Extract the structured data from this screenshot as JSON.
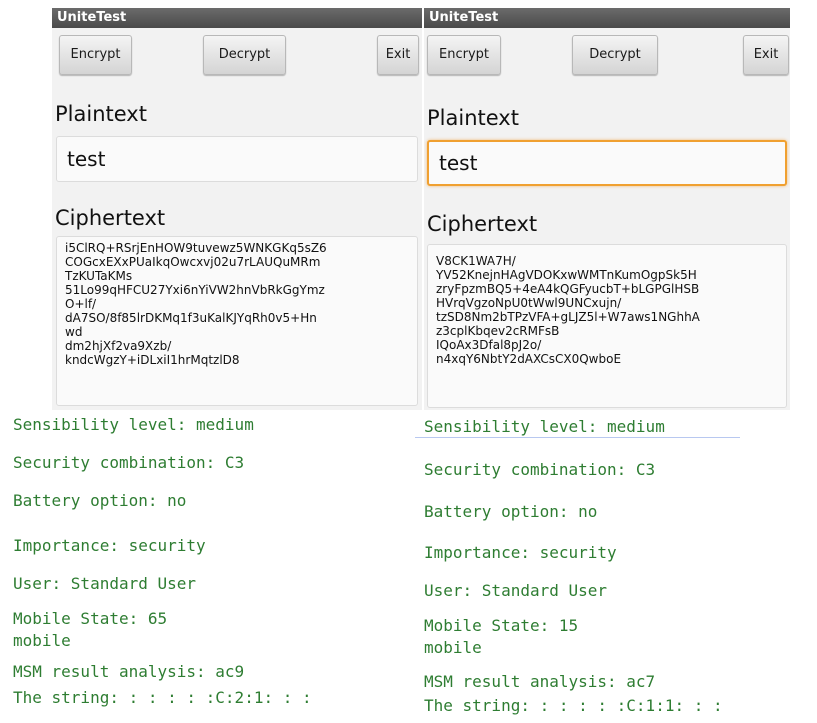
{
  "left_screen": {
    "title": "UniteTest",
    "buttons": {
      "encrypt": "Encrypt",
      "decrypt": "Decrypt",
      "exit": "Exit"
    },
    "plaintext_label": "Plaintext",
    "plaintext_value": "test",
    "ciphertext_label": "Ciphertext",
    "ciphertext_value": "i5ClRQ+RSrjEnHOW9tuvewz5WNKGKq5sZ6\nCOGcxEXxPUaIkqOwcxvj02u7rLAUQuMRm\nTzKUTaKMs\n51Lo99qHFCU27Yxi6nYiVW2hnVbRkGgYmz\nO+lf/\ndA7SO/8f85lrDKMq1f3uKalKJYqRh0v5+Hn\nwd\ndm2hjXf2va9Xzb/\nkndcWgzY+iDLxiI1hrMqtzlD8"
  },
  "right_screen": {
    "title": "UniteTest",
    "buttons": {
      "encrypt": "Encrypt",
      "decrypt": "Decrypt",
      "exit": "Exit"
    },
    "plaintext_label": "Plaintext",
    "plaintext_value": "test",
    "ciphertext_label": "Ciphertext",
    "ciphertext_value": "V8CK1WA7H/\nYV52KnejnHAgVDOKxwWMTnKumOgpSk5H\nzryFpzmBQ5+4eA4kQGFyucbT+bLGPGlHSB\nHVrqVgzoNpU0tWwl9UNCxujn/\ntzSD8Nm2bTPzVFA+gLJZ5l+W7aws1NGhhA\nz3cplKbqev2cRMFsB\nIQoAx3Dfal8pJ2o/\nn4xqY6NbtY2dAXCsCX0QwboE"
  },
  "left_log": {
    "sensibility": "Sensibility level: medium",
    "security": "Security combination: C3",
    "battery": "Battery option: no",
    "importance": "Importance: security",
    "user": "User: Standard User",
    "mobile_state": "Mobile State: 65",
    "mobile": "mobile",
    "msm": "MSM result analysis: ac9",
    "string": "The string: : : : : :C:2:1: : :"
  },
  "right_log": {
    "sensibility": "Sensibility level: medium",
    "security": "Security combination: C3",
    "battery": "Battery option: no",
    "importance": "Importance: security",
    "user": "User: Standard User",
    "mobile_state": "Mobile State: 15",
    "mobile": "mobile",
    "msm": "MSM result analysis: ac7",
    "string": "The string: : : : : :C:1:1: : :"
  },
  "colors": {
    "log_text": "#2e7d32",
    "focus_border": "#f0a030",
    "titlebar": "#4a4a4a"
  }
}
